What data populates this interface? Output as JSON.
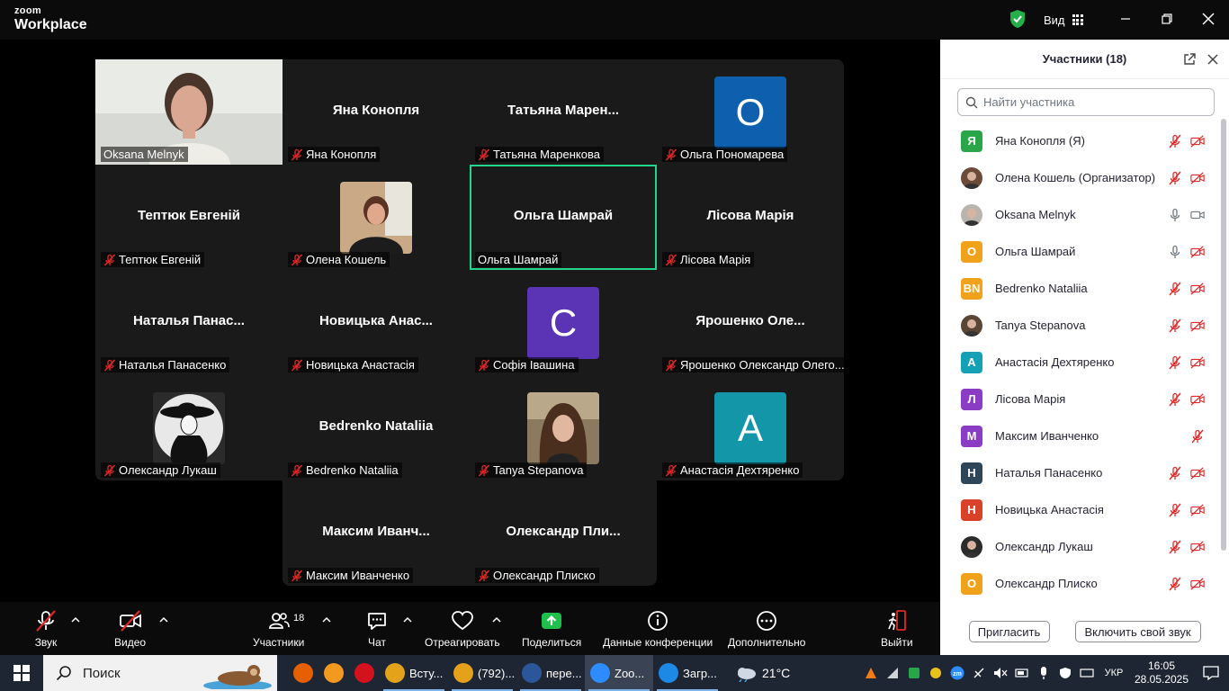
{
  "app": {
    "brand_top": "zoom",
    "brand_bottom": "Workplace",
    "view_label": "Вид"
  },
  "tiles": [
    {
      "label": "Oksana Melnyk",
      "big": "",
      "avatar": "photo-woman-light",
      "muted": false
    },
    {
      "label": "Яна Конопля",
      "big": "Яна Конопля",
      "avatar": "",
      "muted": true
    },
    {
      "label": "Татьяна Маренкова",
      "big": "Татьяна  Марен...",
      "avatar": "",
      "muted": true
    },
    {
      "label": "Ольга Пономарева",
      "big": "",
      "avatar": "О",
      "avatar_color": "#0e5fad",
      "muted": true
    },
    {
      "label": "Тептюк Евгеній",
      "big": "Тептюк Евгеній",
      "avatar": "",
      "muted": true
    },
    {
      "label": "Олена Кошель",
      "big": "",
      "avatar": "photo-woman-dark",
      "muted": true
    },
    {
      "label": "Ольга Шамрай",
      "big": "Ольга Шамрай",
      "avatar": "",
      "muted": false,
      "active": true
    },
    {
      "label": "Лісова Марія",
      "big": "Лісова Марія",
      "avatar": "",
      "muted": true
    },
    {
      "label": "Наталья Панасенко",
      "big": "Наталья  Панас...",
      "avatar": "",
      "muted": true
    },
    {
      "label": "Новицька Анастасія",
      "big": "Новицька  Анас...",
      "avatar": "",
      "muted": true
    },
    {
      "label": "Софія Івашина",
      "big": "",
      "avatar": "С",
      "avatar_color": "#5a34b5",
      "muted": true
    },
    {
      "label": "Ярошенко Олександр Олего...",
      "big": "Ярошенко  Оле...",
      "avatar": "",
      "muted": true
    },
    {
      "label": "Олександр Лукаш",
      "big": "",
      "avatar": "photo-hat",
      "muted": true
    },
    {
      "label": "Bedrenko Nataliia",
      "big": "Bedrenko Nataliia",
      "avatar": "",
      "muted": true
    },
    {
      "label": "Tanya Stepanova",
      "big": "",
      "avatar": "photo-woman-hair",
      "muted": true
    },
    {
      "label": "Анастасія Дехтяренко",
      "big": "",
      "avatar": "А",
      "avatar_color": "#1396a8",
      "muted": true
    },
    {
      "label": "Максим Иванченко",
      "big": "Максим  Иванч...",
      "avatar": "",
      "muted": true
    },
    {
      "label": "Олександр Плиско",
      "big": "Олександр  Пли...",
      "avatar": "",
      "muted": true
    }
  ],
  "panel": {
    "title": "Участники (18)",
    "search_placeholder": "Найти участника",
    "participants": [
      {
        "name": "Яна Конопля (Я)",
        "initials": "Я",
        "color": "#2aa64a",
        "mic": "off",
        "video": "off"
      },
      {
        "name": "Олена Кошель (Организатор)",
        "initials": "",
        "color": "#6b4a3a",
        "mic": "off",
        "video": "off"
      },
      {
        "name": "Oksana Melnyk",
        "initials": "",
        "color": "#b9b4ad",
        "mic": "on",
        "video": "on"
      },
      {
        "name": "Ольга Шамрай",
        "initials": "О",
        "color": "#f0a21a",
        "mic": "on",
        "video": "off"
      },
      {
        "name": "Bedrenko Nataliia",
        "initials": "BN",
        "color": "#f0a21a",
        "mic": "off",
        "video": "off"
      },
      {
        "name": "Tanya Stepanova",
        "initials": "",
        "color": "#5b4636",
        "mic": "off",
        "video": "off"
      },
      {
        "name": "Анастасія Дехтяренко",
        "initials": "А",
        "color": "#14a0b5",
        "mic": "off",
        "video": "off"
      },
      {
        "name": "Лісова Марія",
        "initials": "Л",
        "color": "#8a3cc4",
        "mic": "off",
        "video": "off"
      },
      {
        "name": "Максим Иванченко",
        "initials": "М",
        "color": "#8a3cc4",
        "mic": "off",
        "video": "none"
      },
      {
        "name": "Наталья Панасенко",
        "initials": "Н",
        "color": "#2f4659",
        "mic": "off",
        "video": "off"
      },
      {
        "name": "Новицька Анастасія",
        "initials": "Н",
        "color": "#d9412b",
        "mic": "off",
        "video": "off"
      },
      {
        "name": "Олександр Лукаш",
        "initials": "",
        "color": "#2b2b2b",
        "mic": "off",
        "video": "off"
      },
      {
        "name": "Олександр Плиско",
        "initials": "О",
        "color": "#f0a21a",
        "mic": "off",
        "video": "off"
      }
    ],
    "invite_label": "Пригласить",
    "unmute_label": "Включить свой звук"
  },
  "toolbar": {
    "audio_label": "Звук",
    "video_label": "Видео",
    "participants_label": "Участники",
    "participants_count": "18",
    "chat_label": "Чат",
    "react_label": "Отреагировать",
    "share_label": "Поделиться",
    "meeting_info_label": "Данные конференции",
    "more_label": "Дополнительно",
    "leave_label": "Выйти"
  },
  "taskbar": {
    "search_text": "Поиск",
    "apps": [
      {
        "name": "firefox-icon",
        "label": "",
        "color": "#e66000"
      },
      {
        "name": "pdf-app-icon",
        "label": "",
        "color": "#f29a1f"
      },
      {
        "name": "opera-icon",
        "label": "",
        "color": "#d4121e"
      },
      {
        "name": "chrome-icon",
        "label": "Всту...",
        "color": "#e3a21a"
      },
      {
        "name": "chrome-icon",
        "label": "(792)...",
        "color": "#e3a21a"
      },
      {
        "name": "word-icon",
        "label": "пере...",
        "color": "#2b579a"
      },
      {
        "name": "zoom-icon",
        "label": "Zoo...",
        "color": "#2d8cff",
        "active": true
      },
      {
        "name": "download-icon",
        "label": "Загр...",
        "color": "#1e88e5"
      }
    ],
    "weather": "21°C",
    "language": "УКР",
    "time": "16:05",
    "date": "28.05.2025"
  }
}
